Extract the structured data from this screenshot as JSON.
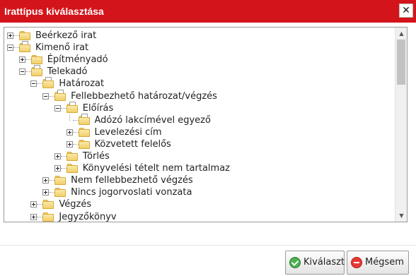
{
  "dialog": {
    "title": "Irattípus kiválasztása",
    "close_label": "✕"
  },
  "tree": {
    "items": [
      {
        "label": "Beérkező irat",
        "level": 0,
        "state": "collapsed",
        "folder": "closed"
      },
      {
        "label": "Kimenő irat",
        "level": 0,
        "state": "expanded",
        "folder": "open"
      },
      {
        "label": "Építményadó",
        "level": 1,
        "state": "collapsed",
        "folder": "closed"
      },
      {
        "label": "Telekadó",
        "level": 1,
        "state": "expanded",
        "folder": "open"
      },
      {
        "label": "Határozat",
        "level": 2,
        "state": "expanded",
        "folder": "open"
      },
      {
        "label": "Fellebbezhető határozat/végzés",
        "level": 3,
        "state": "expanded",
        "folder": "open"
      },
      {
        "label": "Előírás",
        "level": 4,
        "state": "expanded",
        "folder": "open"
      },
      {
        "label": "Adózó lakcímével egyező",
        "level": 5,
        "state": "leaf",
        "folder": "open"
      },
      {
        "label": "Levelezési cím",
        "level": 5,
        "state": "collapsed",
        "folder": "closed"
      },
      {
        "label": "Közvetett felelős",
        "level": 5,
        "state": "collapsed",
        "folder": "closed"
      },
      {
        "label": "Törlés",
        "level": 4,
        "state": "collapsed",
        "folder": "closed"
      },
      {
        "label": "Könyvelési tételt nem tartalmaz",
        "level": 4,
        "state": "collapsed",
        "folder": "closed"
      },
      {
        "label": "Nem fellebbezhető végzés",
        "level": 3,
        "state": "collapsed",
        "folder": "closed"
      },
      {
        "label": "Nincs jogorvoslati vonzata",
        "level": 3,
        "state": "collapsed",
        "folder": "closed"
      },
      {
        "label": "Végzés",
        "level": 2,
        "state": "collapsed",
        "folder": "closed"
      },
      {
        "label": "Jegyzőkönyv",
        "level": 2,
        "state": "collapsed",
        "folder": "closed"
      }
    ]
  },
  "buttons": {
    "select_label": "Kiválaszt",
    "cancel_label": "Mégsem"
  }
}
